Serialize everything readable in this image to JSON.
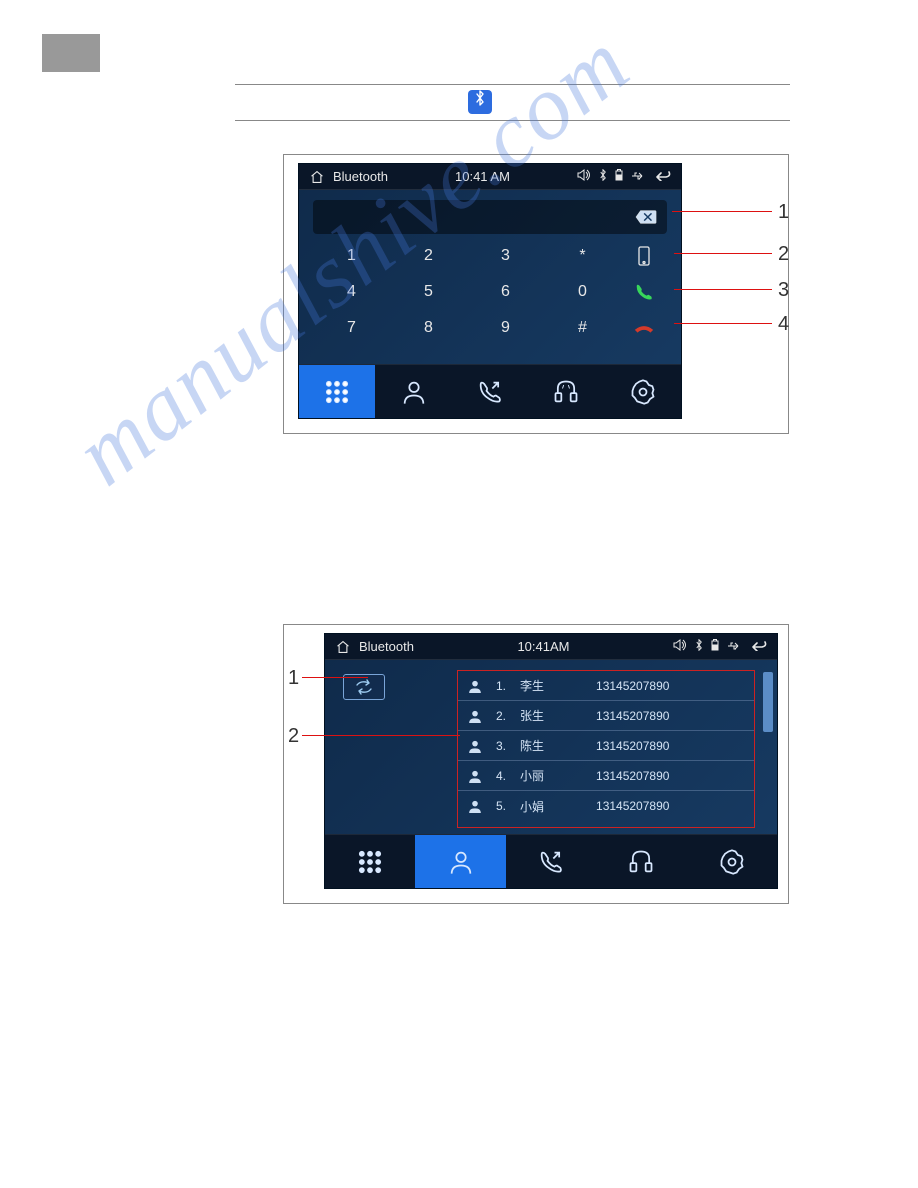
{
  "figure1": {
    "status": {
      "title": "Bluetooth",
      "time": "10:41 AM"
    },
    "keypad": [
      [
        "1",
        "2",
        "3",
        "*"
      ],
      [
        "4",
        "5",
        "6",
        "0"
      ],
      [
        "7",
        "8",
        "9",
        "#"
      ]
    ],
    "callouts": {
      "1": "1",
      "2": "2",
      "3": "3",
      "4": "4"
    }
  },
  "figure2": {
    "status": {
      "title": "Bluetooth",
      "time": "10:41AM"
    },
    "contacts": [
      {
        "idx": "1.",
        "name": "李生",
        "phone": "13145207890"
      },
      {
        "idx": "2.",
        "name": "张生",
        "phone": "13145207890"
      },
      {
        "idx": "3.",
        "name": "陈生",
        "phone": "13145207890"
      },
      {
        "idx": "4.",
        "name": "小丽",
        "phone": "13145207890"
      },
      {
        "idx": "5.",
        "name": "小娟",
        "phone": "13145207890"
      }
    ],
    "callouts": {
      "1": "1",
      "2": "2"
    }
  },
  "watermark": "manualshive.com"
}
